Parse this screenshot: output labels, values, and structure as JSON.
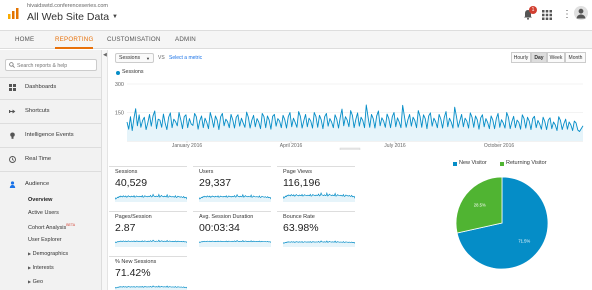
{
  "header": {
    "account_url": "hivaidswtd.conferenceseries.com",
    "view_name": "All Web Site Data",
    "notification_count": "1"
  },
  "nav": {
    "tabs": [
      {
        "label": "HOME",
        "active": false
      },
      {
        "label": "REPORTING",
        "active": true
      },
      {
        "label": "CUSTOMISATION",
        "active": false
      },
      {
        "label": "ADMIN",
        "active": false
      }
    ]
  },
  "sidebar": {
    "search_placeholder": "Search reports & help",
    "items": [
      {
        "label": "Dashboards",
        "icon": "grid-icon"
      },
      {
        "label": "Shortcuts",
        "icon": "shortcut-arrow-icon"
      },
      {
        "label": "Intelligence Events",
        "icon": "lightbulb-icon"
      },
      {
        "label": "Real Time",
        "icon": "clock-icon"
      },
      {
        "label": "Audience",
        "icon": "person-icon"
      }
    ],
    "audience_sub": {
      "overview": "Overview",
      "active_users": "Active Users",
      "cohort_analysis": "Cohort Analysis",
      "beta": "BETA",
      "user_explorer": "User Explorer",
      "demographics": "Demographics",
      "interests": "Interests",
      "geo": "Geo"
    }
  },
  "toolbar": {
    "metric_select": "Sessions",
    "vs_label": "VS",
    "select_metric_link": "Select a metric",
    "ranges": [
      {
        "label": "Hourly",
        "active": false
      },
      {
        "label": "Day",
        "active": true
      },
      {
        "label": "Week",
        "active": false
      },
      {
        "label": "Month",
        "active": false
      }
    ]
  },
  "chart_data": [
    {
      "type": "area",
      "legend": [
        "Sessions"
      ],
      "y_ticks": [
        "300",
        "150"
      ],
      "ylim": [
        0,
        300
      ],
      "x_tick_labels": [
        "January 2016",
        "April 2016",
        "July 2016",
        "October 2016"
      ],
      "colors": {
        "line": "#058dc7",
        "fill": "#e6f4fa",
        "grid": "#e8e8e8"
      },
      "series": [
        {
          "name": "Sessions",
          "values": [
            100,
            62,
            128,
            55,
            120,
            170,
            80,
            138,
            72,
            108,
            125,
            60,
            96,
            140,
            78,
            132,
            158,
            65,
            115,
            110,
            72,
            142,
            95,
            60,
            125,
            148,
            70,
            115,
            102,
            80,
            150,
            112,
            65,
            128,
            138,
            70,
            118,
            90,
            82,
            145,
            128,
            62,
            108,
            132,
            70,
            120,
            98,
            65,
            150,
            118,
            72,
            132,
            110,
            60,
            128,
            145,
            80,
            115,
            102,
            70,
            140,
            112,
            68,
            125,
            138,
            78,
            120,
            95,
            72,
            152,
            125,
            68,
            110,
            135,
            75,
            118,
            100,
            65,
            145,
            128,
            70,
            132,
            110,
            62,
            130,
            140,
            78,
            118,
            105,
            70,
            135,
            112,
            68,
            128,
            150,
            75,
            120,
            98,
            72,
            155,
            130,
            68,
            108,
            140,
            75,
            120,
            105,
            68,
            150,
            128,
            72,
            135,
            112,
            65,
            128,
            145,
            78,
            118,
            100,
            70,
            138,
            115,
            68,
            125,
            168,
            80,
            128,
            110,
            75,
            160,
            135,
            70,
            115,
            148,
            78,
            125,
            108,
            70,
            190,
            128,
            72,
            140,
            118,
            68,
            132,
            158,
            80,
            122,
            105,
            72,
            142,
            118,
            70,
            128,
            150,
            75,
            122,
            100,
            70,
            188,
            130,
            72,
            112,
            140,
            78,
            125,
            108,
            70,
            160,
            130,
            72,
            138,
            118,
            65,
            132,
            148,
            78,
            120,
            102,
            70,
            140,
            115,
            68,
            125,
            155,
            75,
            120,
            100,
            68,
            178,
            130,
            72,
            108,
            140,
            75,
            120,
            105,
            68,
            148,
            125,
            72,
            132,
            112,
            62,
            122,
            138,
            75,
            118,
            98,
            65,
            132,
            110,
            65,
            118,
            145,
            72,
            112,
            95,
            68,
            150,
            125,
            65,
            102,
            130,
            70,
            110,
            98,
            62,
            138,
            118,
            68,
            125,
            105,
            60,
            118,
            130,
            70,
            108,
            90,
            62,
            125,
            102,
            60,
            110,
            122,
            65,
            100,
            85,
            55,
            128,
            108,
            60,
            92,
            115,
            62,
            100,
            85,
            55,
            105,
            95,
            58,
            50,
            65,
            80
          ]
        }
      ]
    },
    {
      "type": "pie",
      "legend": [
        "New Visitor",
        "Returning Visitor"
      ],
      "series": [
        {
          "name": "New Visitor",
          "value": 71.5,
          "color": "#058dc7"
        },
        {
          "name": "Returning Visitor",
          "value": 28.5,
          "color": "#50b432"
        }
      ],
      "slice_labels": [
        "71.5%",
        "28.5%"
      ]
    }
  ],
  "scorecards": [
    {
      "label": "Sessions",
      "value": "40,529"
    },
    {
      "label": "Users",
      "value": "29,337"
    },
    {
      "label": "Page Views",
      "value": "116,196"
    },
    {
      "label": "Pages/Session",
      "value": "2.87"
    },
    {
      "label": "Avg. Session Duration",
      "value": "00:03:34"
    },
    {
      "label": "Bounce Rate",
      "value": "63.98%"
    },
    {
      "label": "% New Sessions",
      "value": "71.42%"
    }
  ]
}
